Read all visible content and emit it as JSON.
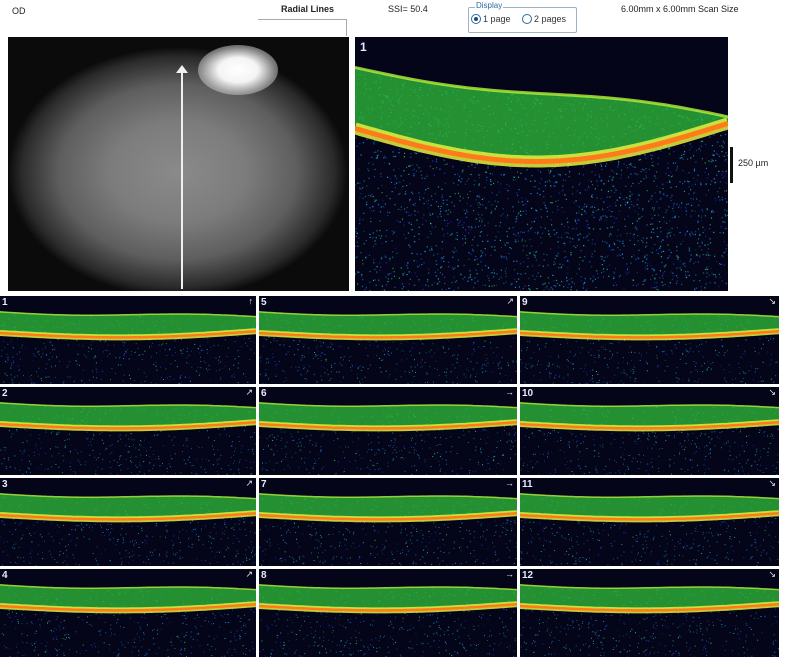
{
  "header": {
    "eye_label": "OD",
    "scan_pattern": "Radial Lines",
    "ssi": "SSI= 50.4",
    "display": {
      "title": "Display",
      "options": [
        "1 page",
        "2 pages"
      ],
      "selected": "1 page"
    },
    "scan_size": "6.00mm x 6.00mm Scan Size"
  },
  "main_scan": {
    "label": "1"
  },
  "scale_bar": {
    "label": "250 µm"
  },
  "thumbnails": [
    {
      "label": "1",
      "direction_icon": "↑"
    },
    {
      "label": "2",
      "direction_icon": "↗"
    },
    {
      "label": "3",
      "direction_icon": "↗"
    },
    {
      "label": "4",
      "direction_icon": "↗"
    },
    {
      "label": "5",
      "direction_icon": "↗"
    },
    {
      "label": "6",
      "direction_icon": "→"
    },
    {
      "label": "7",
      "direction_icon": "→"
    },
    {
      "label": "8",
      "direction_icon": "→"
    },
    {
      "label": "9",
      "direction_icon": "↘"
    },
    {
      "label": "10",
      "direction_icon": "↘"
    },
    {
      "label": "11",
      "direction_icon": "↘"
    },
    {
      "label": "12",
      "direction_icon": "↘"
    }
  ]
}
